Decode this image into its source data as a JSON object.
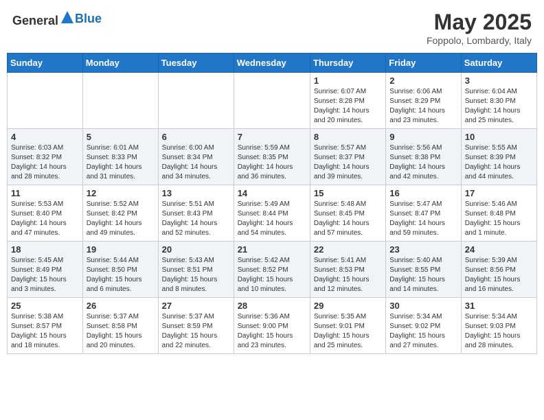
{
  "header": {
    "logo_general": "General",
    "logo_blue": "Blue",
    "month_year": "May 2025",
    "location": "Foppolo, Lombardy, Italy"
  },
  "weekdays": [
    "Sunday",
    "Monday",
    "Tuesday",
    "Wednesday",
    "Thursday",
    "Friday",
    "Saturday"
  ],
  "weeks": [
    [
      {
        "day": "",
        "info": ""
      },
      {
        "day": "",
        "info": ""
      },
      {
        "day": "",
        "info": ""
      },
      {
        "day": "",
        "info": ""
      },
      {
        "day": "1",
        "info": "Sunrise: 6:07 AM\nSunset: 8:28 PM\nDaylight: 14 hours\nand 20 minutes."
      },
      {
        "day": "2",
        "info": "Sunrise: 6:06 AM\nSunset: 8:29 PM\nDaylight: 14 hours\nand 23 minutes."
      },
      {
        "day": "3",
        "info": "Sunrise: 6:04 AM\nSunset: 8:30 PM\nDaylight: 14 hours\nand 25 minutes."
      }
    ],
    [
      {
        "day": "4",
        "info": "Sunrise: 6:03 AM\nSunset: 8:32 PM\nDaylight: 14 hours\nand 28 minutes."
      },
      {
        "day": "5",
        "info": "Sunrise: 6:01 AM\nSunset: 8:33 PM\nDaylight: 14 hours\nand 31 minutes."
      },
      {
        "day": "6",
        "info": "Sunrise: 6:00 AM\nSunset: 8:34 PM\nDaylight: 14 hours\nand 34 minutes."
      },
      {
        "day": "7",
        "info": "Sunrise: 5:59 AM\nSunset: 8:35 PM\nDaylight: 14 hours\nand 36 minutes."
      },
      {
        "day": "8",
        "info": "Sunrise: 5:57 AM\nSunset: 8:37 PM\nDaylight: 14 hours\nand 39 minutes."
      },
      {
        "day": "9",
        "info": "Sunrise: 5:56 AM\nSunset: 8:38 PM\nDaylight: 14 hours\nand 42 minutes."
      },
      {
        "day": "10",
        "info": "Sunrise: 5:55 AM\nSunset: 8:39 PM\nDaylight: 14 hours\nand 44 minutes."
      }
    ],
    [
      {
        "day": "11",
        "info": "Sunrise: 5:53 AM\nSunset: 8:40 PM\nDaylight: 14 hours\nand 47 minutes."
      },
      {
        "day": "12",
        "info": "Sunrise: 5:52 AM\nSunset: 8:42 PM\nDaylight: 14 hours\nand 49 minutes."
      },
      {
        "day": "13",
        "info": "Sunrise: 5:51 AM\nSunset: 8:43 PM\nDaylight: 14 hours\nand 52 minutes."
      },
      {
        "day": "14",
        "info": "Sunrise: 5:49 AM\nSunset: 8:44 PM\nDaylight: 14 hours\nand 54 minutes."
      },
      {
        "day": "15",
        "info": "Sunrise: 5:48 AM\nSunset: 8:45 PM\nDaylight: 14 hours\nand 57 minutes."
      },
      {
        "day": "16",
        "info": "Sunrise: 5:47 AM\nSunset: 8:47 PM\nDaylight: 14 hours\nand 59 minutes."
      },
      {
        "day": "17",
        "info": "Sunrise: 5:46 AM\nSunset: 8:48 PM\nDaylight: 15 hours\nand 1 minute."
      }
    ],
    [
      {
        "day": "18",
        "info": "Sunrise: 5:45 AM\nSunset: 8:49 PM\nDaylight: 15 hours\nand 3 minutes."
      },
      {
        "day": "19",
        "info": "Sunrise: 5:44 AM\nSunset: 8:50 PM\nDaylight: 15 hours\nand 6 minutes."
      },
      {
        "day": "20",
        "info": "Sunrise: 5:43 AM\nSunset: 8:51 PM\nDaylight: 15 hours\nand 8 minutes."
      },
      {
        "day": "21",
        "info": "Sunrise: 5:42 AM\nSunset: 8:52 PM\nDaylight: 15 hours\nand 10 minutes."
      },
      {
        "day": "22",
        "info": "Sunrise: 5:41 AM\nSunset: 8:53 PM\nDaylight: 15 hours\nand 12 minutes."
      },
      {
        "day": "23",
        "info": "Sunrise: 5:40 AM\nSunset: 8:55 PM\nDaylight: 15 hours\nand 14 minutes."
      },
      {
        "day": "24",
        "info": "Sunrise: 5:39 AM\nSunset: 8:56 PM\nDaylight: 15 hours\nand 16 minutes."
      }
    ],
    [
      {
        "day": "25",
        "info": "Sunrise: 5:38 AM\nSunset: 8:57 PM\nDaylight: 15 hours\nand 18 minutes."
      },
      {
        "day": "26",
        "info": "Sunrise: 5:37 AM\nSunset: 8:58 PM\nDaylight: 15 hours\nand 20 minutes."
      },
      {
        "day": "27",
        "info": "Sunrise: 5:37 AM\nSunset: 8:59 PM\nDaylight: 15 hours\nand 22 minutes."
      },
      {
        "day": "28",
        "info": "Sunrise: 5:36 AM\nSunset: 9:00 PM\nDaylight: 15 hours\nand 23 minutes."
      },
      {
        "day": "29",
        "info": "Sunrise: 5:35 AM\nSunset: 9:01 PM\nDaylight: 15 hours\nand 25 minutes."
      },
      {
        "day": "30",
        "info": "Sunrise: 5:34 AM\nSunset: 9:02 PM\nDaylight: 15 hours\nand 27 minutes."
      },
      {
        "day": "31",
        "info": "Sunrise: 5:34 AM\nSunset: 9:03 PM\nDaylight: 15 hours\nand 28 minutes."
      }
    ]
  ]
}
